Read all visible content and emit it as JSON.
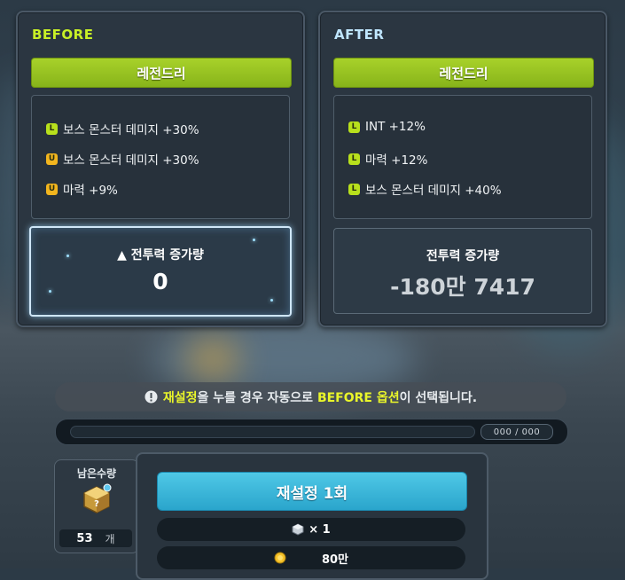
{
  "before": {
    "header": "BEFORE",
    "grade": "레전드리",
    "options": [
      {
        "badge": "L",
        "text": "보스 몬스터 데미지 +30%"
      },
      {
        "badge": "U",
        "text": "보스 몬스터 데미지 +30%"
      },
      {
        "badge": "U",
        "text": "마력 +9%"
      }
    ],
    "power_title": "▲ 전투력 증가량",
    "power_value": "0"
  },
  "after": {
    "header": "AFTER",
    "grade": "레전드리",
    "options": [
      {
        "badge": "L",
        "text": "INT +12%"
      },
      {
        "badge": "L",
        "text": "마력 +12%"
      },
      {
        "badge": "L",
        "text": "보스 몬스터 데미지 +40%"
      }
    ],
    "power_title": "전투력 증가량",
    "power_value": "-180만 7417"
  },
  "notice": {
    "pre": "재설정",
    "mid": "을 누를 경우 자동으로 ",
    "highlight": "BEFORE 옵션",
    "post": "이 선택됩니다."
  },
  "progress": {
    "label": "000 / 000",
    "fraction": 0
  },
  "remaining": {
    "label": "남은수량",
    "count": "53",
    "unit": "개"
  },
  "action": {
    "button_label": "재설정 1회",
    "cube_cost": "× 1",
    "meso_cost": "80만"
  },
  "colors": {
    "legendary_green": "#a8d12a",
    "before_header": "#c8f026",
    "after_header": "#bfe6ff",
    "button_blue": "#3bb7dc",
    "badge_L": "#b8e01c",
    "badge_U": "#f2b51e"
  },
  "icons": {
    "notice": "exclamation-circle-icon",
    "cube": "cube-icon",
    "meso": "meso-coin-icon"
  }
}
